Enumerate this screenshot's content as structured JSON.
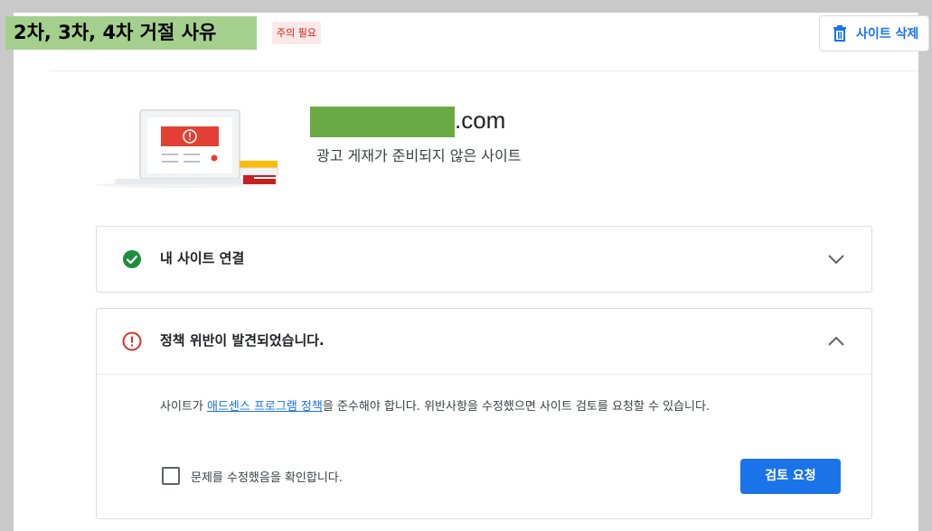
{
  "header": {
    "overlay_label": "2차, 3차, 4차 거절 사유",
    "warning_badge": "주의 필요",
    "delete_button_label": "사이트 삭제",
    "delete_icon": "trash-icon"
  },
  "site": {
    "domain_suffix": ".com",
    "status_text": "광고 게재가 준비되지 않은 사이트"
  },
  "panels": [
    {
      "title": "내 사이트 연결",
      "status_icon": "check-circle-icon",
      "status_color": "#1e8e3e",
      "expanded": false
    },
    {
      "title": "정책 위반이 발견되었습니다.",
      "status_icon": "error-circle-icon",
      "status_color": "#d93025",
      "expanded": true,
      "body": {
        "text_before": "사이트가 ",
        "link_text": "애드센스 프로그램 정책",
        "text_after": "을 준수해야 합니다. 위반사항을 수정했으면 사이트 검토를 요청할 수 있습니다.",
        "checkbox_label": "문제를 수정했음을 확인합니다.",
        "checkbox_checked": false,
        "review_button_label": "검토 요청"
      }
    }
  ],
  "colors": {
    "accent": "#1a73e8",
    "overlay_label_bg": "#a5cf8c",
    "domain_mask": "#6aaa44"
  }
}
